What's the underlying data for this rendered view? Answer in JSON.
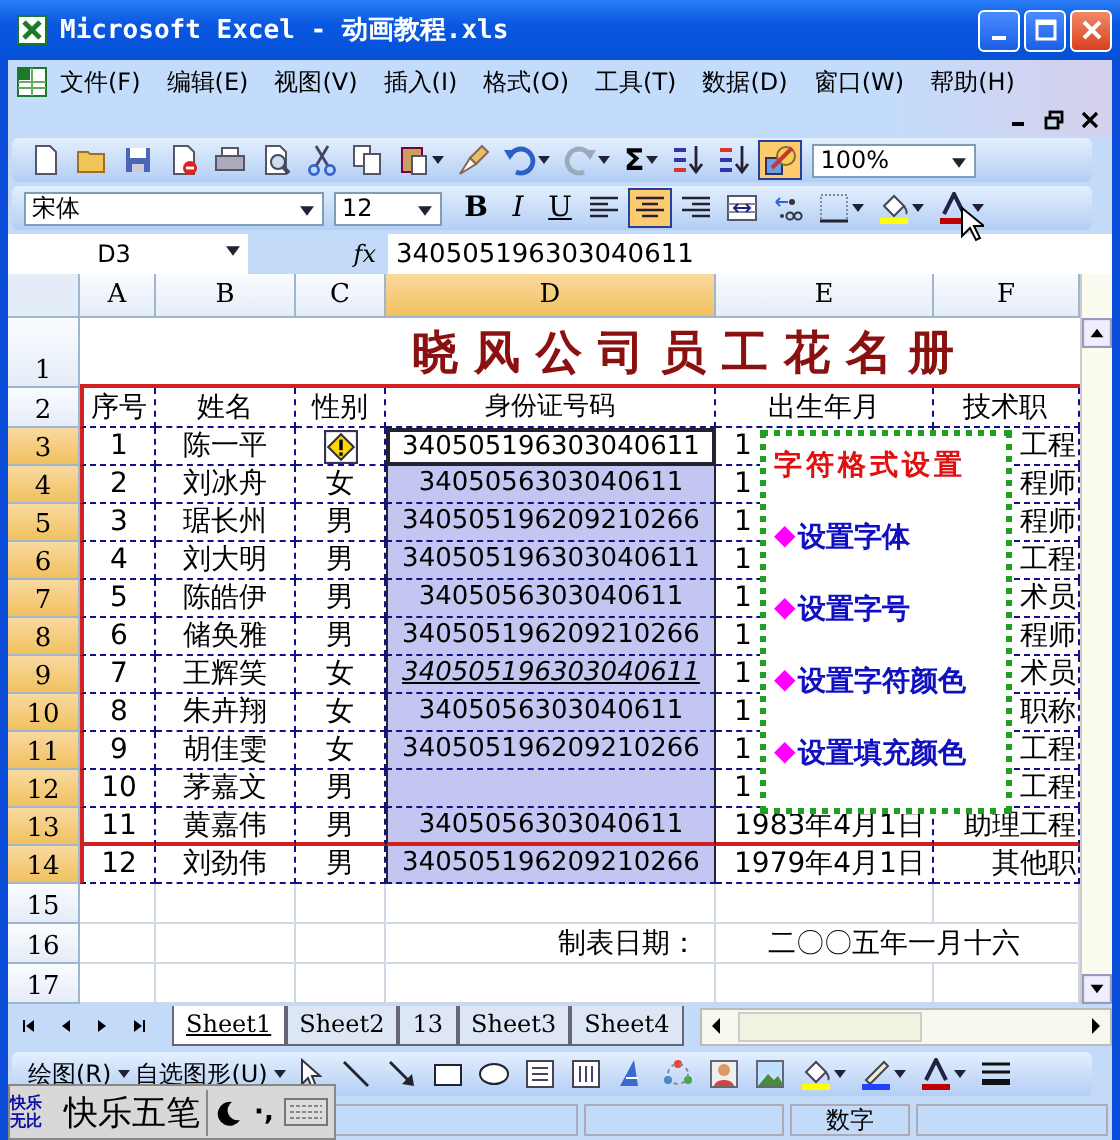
{
  "window": {
    "title": "Microsoft Excel - 动画教程.xls"
  },
  "menu": [
    "文件(F)",
    "编辑(E)",
    "视图(V)",
    "插入(I)",
    "格式(O)",
    "工具(T)",
    "数据(D)",
    "窗口(W)",
    "帮助(H)"
  ],
  "standard_toolbar": {
    "buttons": [
      {
        "kind": "new",
        "on": false
      },
      {
        "kind": "open",
        "on": false
      },
      {
        "kind": "save",
        "on": false
      },
      {
        "kind": "permission",
        "on": false
      },
      {
        "kind": "print",
        "on": false
      },
      {
        "kind": "preview",
        "on": false
      },
      {
        "kind": "cut",
        "on": false
      },
      {
        "kind": "copy",
        "on": false
      },
      {
        "kind": "paste",
        "on": false
      },
      {
        "kind": "painter",
        "on": false
      },
      {
        "kind": "undo",
        "on": false
      },
      {
        "kind": "redo",
        "on": false
      },
      {
        "kind": "sum",
        "label": "Σ",
        "on": false
      },
      {
        "kind": "sort-asc",
        "on": false
      },
      {
        "kind": "sort-desc",
        "on": false
      },
      {
        "kind": "drawing",
        "on": true
      }
    ],
    "zoom": "100%"
  },
  "formatting_toolbar": {
    "font": "宋体",
    "size": "12",
    "buttons": [
      {
        "kind": "bold",
        "label": "B",
        "on": false
      },
      {
        "kind": "italic",
        "label": "I",
        "on": false
      },
      {
        "kind": "underline",
        "label": "U",
        "on": false
      },
      {
        "kind": "align-left",
        "on": false
      },
      {
        "kind": "align-center",
        "on": true
      },
      {
        "kind": "align-right",
        "on": false
      },
      {
        "kind": "merge",
        "on": false
      },
      {
        "kind": "decimal",
        "on": false
      },
      {
        "kind": "borders",
        "on": false
      },
      {
        "kind": "fill-color",
        "on": false
      },
      {
        "kind": "font-color",
        "on": false
      }
    ]
  },
  "formula_bar": {
    "name_box": "D3",
    "fx": "fx",
    "value": "340505196303040611"
  },
  "columns": [
    {
      "label": "A",
      "selected": false
    },
    {
      "label": "B",
      "selected": false
    },
    {
      "label": "C",
      "selected": false
    },
    {
      "label": "D",
      "selected": true
    },
    {
      "label": "E",
      "selected": false
    },
    {
      "label": "F",
      "selected": false
    }
  ],
  "rows": [
    {
      "num": "1",
      "kind": "title",
      "selected": false,
      "title": "晓风公司员工花名册"
    },
    {
      "num": "2",
      "kind": "header",
      "selected": false,
      "cells": [
        "序号",
        "姓名",
        "性别",
        "身份证号码",
        "出生年月",
        "技术职"
      ]
    },
    {
      "num": "3",
      "kind": "data",
      "selected": true,
      "cells": [
        "1",
        "陈一平",
        {
          "kind": "warning"
        },
        {
          "kind": "text",
          "text": "340505196303040611",
          "active": true
        },
        "1",
        "工程"
      ]
    },
    {
      "num": "4",
      "kind": "data",
      "selected": true,
      "cells": [
        "2",
        "刘冰舟",
        "女",
        "3405056303040611",
        "1",
        "程师"
      ]
    },
    {
      "num": "5",
      "kind": "data",
      "selected": true,
      "cells": [
        "3",
        "琚长州",
        "男",
        "340505196209210266",
        "1",
        "程师"
      ]
    },
    {
      "num": "6",
      "kind": "data",
      "selected": true,
      "cells": [
        "4",
        "刘大明",
        "男",
        "340505196303040611",
        "1",
        "工程"
      ]
    },
    {
      "num": "7",
      "kind": "data",
      "selected": true,
      "cells": [
        "5",
        "陈皓伊",
        "男",
        "3405056303040611",
        "1",
        "术员"
      ]
    },
    {
      "num": "8",
      "kind": "data",
      "selected": true,
      "cells": [
        "6",
        "储奂雅",
        "男",
        "340505196209210266",
        "1",
        "程师"
      ]
    },
    {
      "num": "9",
      "kind": "data",
      "selected": true,
      "cells": [
        "7",
        "王辉笑",
        "女",
        {
          "kind": "text",
          "text": "340505196303040611",
          "italic": true
        },
        "1",
        "术员"
      ]
    },
    {
      "num": "10",
      "kind": "data",
      "selected": true,
      "cells": [
        "8",
        "朱卉翔",
        "女",
        "3405056303040611",
        "1",
        "职称"
      ]
    },
    {
      "num": "11",
      "kind": "data",
      "selected": true,
      "cells": [
        "9",
        "胡佳雯",
        "女",
        "340505196209210266",
        "1",
        "工程"
      ]
    },
    {
      "num": "12",
      "kind": "data",
      "selected": true,
      "cells": [
        "10",
        "茅嘉文",
        "男",
        null,
        "1",
        "工程"
      ]
    },
    {
      "num": "13",
      "kind": "data",
      "selected": true,
      "cells": [
        "11",
        "黄嘉伟",
        "男",
        "3405056303040611",
        "1983年4月1日",
        "助理工程"
      ]
    },
    {
      "num": "14",
      "kind": "data",
      "selected": true,
      "cells": [
        "12",
        "刘劲伟",
        "男",
        "340505196209210266",
        "1979年4月1日",
        "其他职"
      ]
    },
    {
      "num": "15",
      "kind": "blank",
      "selected": false
    },
    {
      "num": "16",
      "kind": "footer",
      "selected": false,
      "label": "制表日期：",
      "date": "二〇〇五年一月十六"
    },
    {
      "num": "17",
      "kind": "blank",
      "selected": false
    }
  ],
  "text_box": {
    "title": "字符格式设置",
    "items": [
      {
        "bullet": "◆",
        "text": "设置字体"
      },
      {
        "bullet": "◆",
        "text": "设置字号"
      },
      {
        "bullet": "◆",
        "text": "设置字符颜色"
      },
      {
        "bullet": "◆",
        "text": "设置填充颜色"
      }
    ]
  },
  "sheet_tabs": [
    {
      "label": "Sheet1",
      "selected": true
    },
    {
      "label": "Sheet2",
      "selected": false
    },
    {
      "label": "13",
      "selected": false
    },
    {
      "label": "Sheet3",
      "selected": false
    },
    {
      "label": "Sheet4",
      "selected": false
    }
  ],
  "drawing_toolbar": {
    "draw_menu": "绘图(R)",
    "autoshapes": "自选图形(U)",
    "buttons": [
      {
        "kind": "select"
      },
      {
        "kind": "line"
      },
      {
        "kind": "arrow"
      },
      {
        "kind": "rect"
      },
      {
        "kind": "ellipse"
      },
      {
        "kind": "textbox"
      },
      {
        "kind": "vtextbox"
      },
      {
        "kind": "wordart"
      },
      {
        "kind": "diagram"
      },
      {
        "kind": "clipart"
      },
      {
        "kind": "picture"
      },
      {
        "kind": "fill-color"
      },
      {
        "kind": "line-color"
      },
      {
        "kind": "font-color"
      },
      {
        "kind": "line-style"
      }
    ]
  },
  "status_bar": {
    "mode": "数字"
  },
  "ime_bar": {
    "logo": "快乐无比",
    "name": "快乐五笔",
    "punctuation": "·,"
  }
}
